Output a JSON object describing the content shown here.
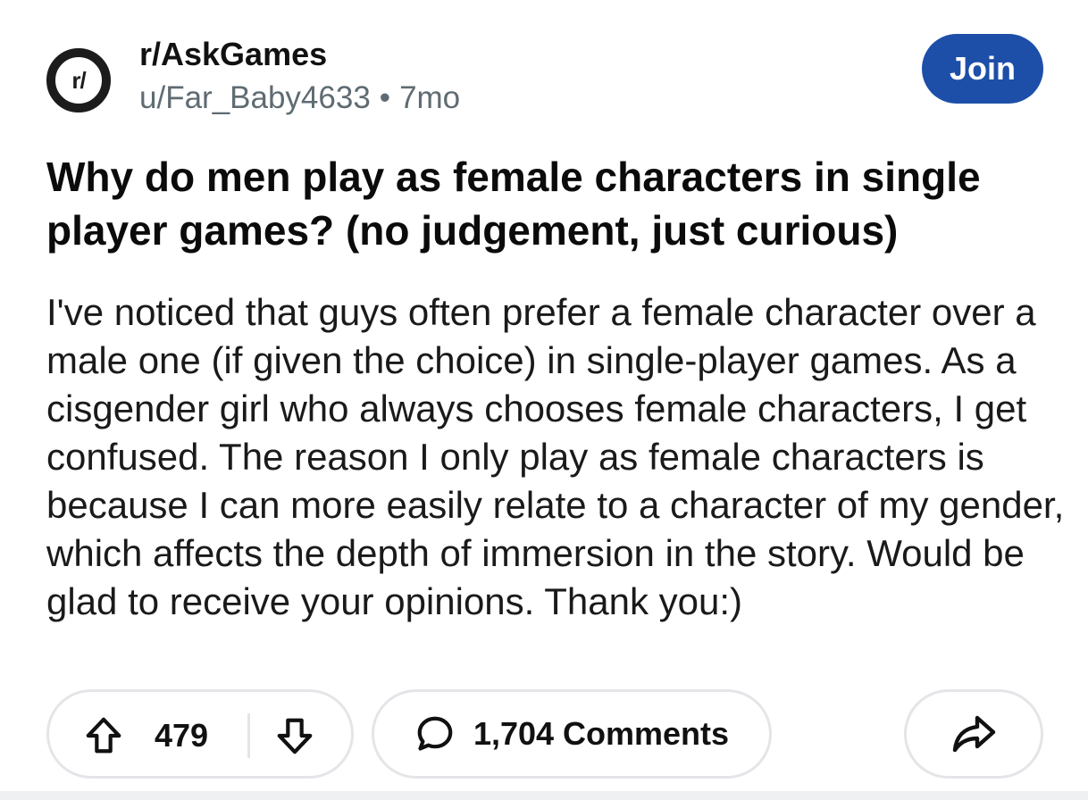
{
  "post": {
    "subreddit_icon_text": "r/",
    "subreddit": "r/AskGames",
    "author": "u/Far_Baby4633",
    "separator": "•",
    "age": "7mo",
    "join_label": "Join",
    "title": "Why do men play as female characters in single player games? (no judgement, just curious)",
    "body": "I've noticed that guys often prefer a female character over a male one (if given the choice) in single-player games. As a cisgender girl who always chooses female characters, I get confused. The reason I only play as female characters is because I can more easily relate to a character of my gender, which affects the depth of immersion in the story. Would be glad to receive your opinions. Thank you:)"
  },
  "actions": {
    "upvote_icon": "upvote-arrow-icon",
    "vote_count": "479",
    "downvote_icon": "downvote-arrow-icon",
    "comment_icon": "comment-bubble-icon",
    "comments_label": "1,704 Comments",
    "share_icon": "share-arrow-icon"
  },
  "colors": {
    "join_button": "#1d4fa8",
    "pill_border": "#e3e5e8",
    "meta_text": "#5f6b72"
  }
}
